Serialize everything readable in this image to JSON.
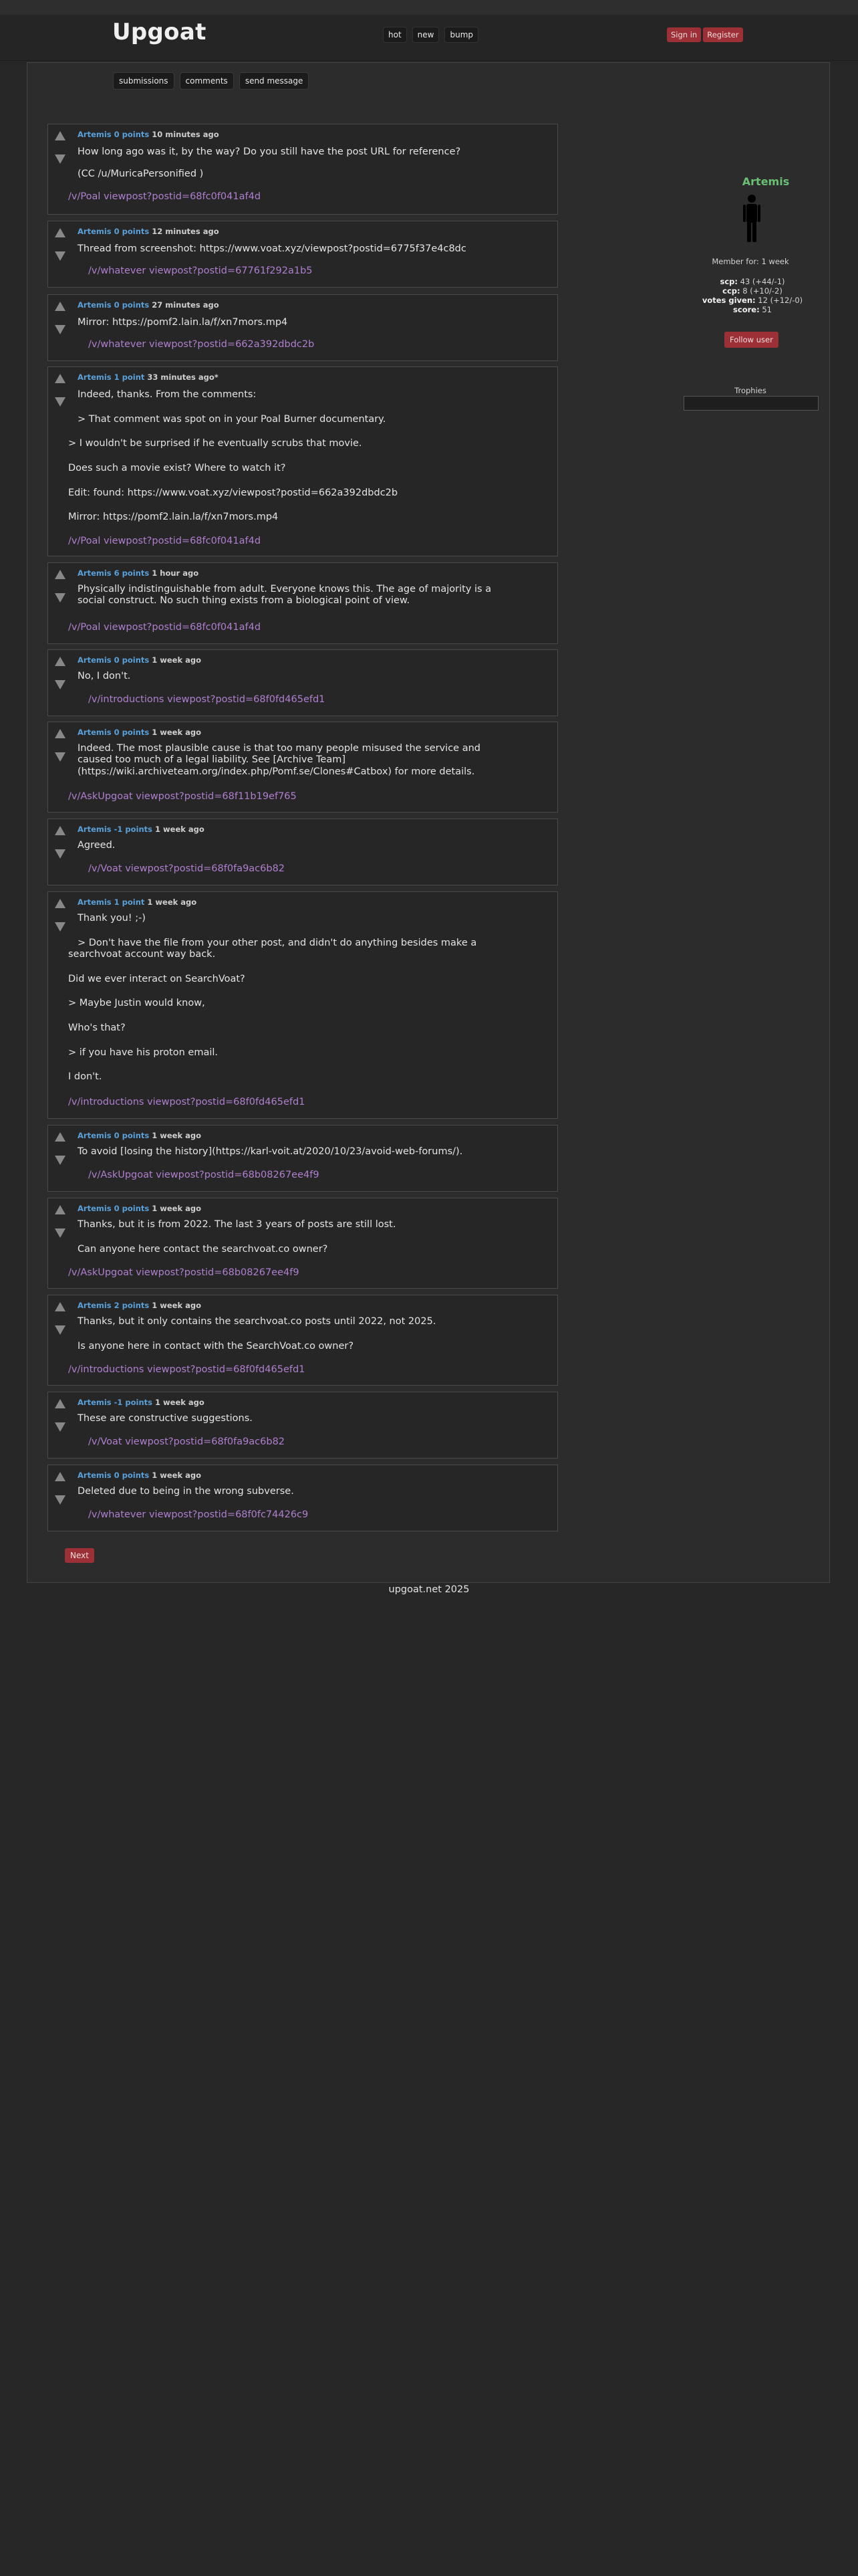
{
  "header": {
    "logo": "Upgoat",
    "nav": [
      "hot",
      "new",
      "bump"
    ],
    "sign_in": "Sign in",
    "register": "Register"
  },
  "subnav": [
    "submissions",
    "comments",
    "send message"
  ],
  "comments": [
    {
      "author": "Artemis",
      "points": "0 points",
      "time": "10 minutes ago",
      "lines": [
        "How long ago was it, by the way? Do you still have the post URL for reference?",
        "(CC /u/MuricaPersonified )"
      ],
      "link": "/v/Poal viewpost?postid=68fc0f041af4d"
    },
    {
      "author": "Artemis",
      "points": "0 points",
      "time": "12 minutes ago",
      "lines": [
        "Thread from screenshot: https://www.voat.xyz/viewpost?postid=6775f37e4c8dc"
      ],
      "link": "/v/whatever viewpost?postid=67761f292a1b5"
    },
    {
      "author": "Artemis",
      "points": "0 points",
      "time": "27 minutes ago",
      "lines": [
        "Mirror: https://pomf2.lain.la/f/xn7mors.mp4"
      ],
      "link": "/v/whatever viewpost?postid=662a392dbdc2b"
    },
    {
      "author": "Artemis",
      "points": "1 point",
      "time": "33 minutes ago*",
      "lines": [
        "Indeed, thanks. From the comments:",
        "> That comment was spot on in your Poal Burner documentary.",
        "> I wouldn't be surprised if he eventually scrubs that movie.",
        "Does such a movie exist? Where to watch it?",
        "Edit: found: https://www.voat.xyz/viewpost?postid=662a392dbdc2b",
        "Mirror: https://pomf2.lain.la/f/xn7mors.mp4"
      ],
      "link": "/v/Poal viewpost?postid=68fc0f041af4d"
    },
    {
      "author": "Artemis",
      "points": "6 points",
      "time": "1 hour ago",
      "lines": [
        "Physically indistinguishable from adult. Everyone knows this. The age of majority is a",
        "social construct. No such thing exists from a biological point of view."
      ],
      "link": "/v/Poal viewpost?postid=68fc0f041af4d"
    },
    {
      "author": "Artemis",
      "points": "0 points",
      "time": "1 week ago",
      "lines": [
        "No, I don't."
      ],
      "link": "/v/introductions viewpost?postid=68f0fd465efd1"
    },
    {
      "author": "Artemis",
      "points": "0 points",
      "time": "1 week ago",
      "lines": [
        "Indeed. The most plausible cause is that too many people misused the service and",
        "caused too much of a legal liability. See [Archive Team]",
        "(https://wiki.archiveteam.org/index.php/Pomf.se/Clones#Catbox) for more details."
      ],
      "link": "/v/AskUpgoat viewpost?postid=68f11b19ef765"
    },
    {
      "author": "Artemis",
      "points": "-1 points",
      "time": "1 week ago",
      "lines": [
        "Agreed."
      ],
      "link": "/v/Voat viewpost?postid=68f0fa9ac6b82"
    },
    {
      "author": "Artemis",
      "points": "1 point",
      "time": "1 week ago",
      "lines": [
        "Thank you! ;-)",
        "> Don't have the file from your other post, and didn't do anything besides make a",
        "searchvoat account way back.",
        "Did we ever interact on SearchVoat?",
        "> Maybe Justin would know,",
        "Who's that?",
        "> if you have his proton email.",
        "I don't."
      ],
      "link": "/v/introductions viewpost?postid=68f0fd465efd1"
    },
    {
      "author": "Artemis",
      "points": "0 points",
      "time": "1 week ago",
      "lines": [
        "To avoid [losing the history](https://karl-voit.at/2020/10/23/avoid-web-forums/)."
      ],
      "link": "/v/AskUpgoat viewpost?postid=68b08267ee4f9"
    },
    {
      "author": "Artemis",
      "points": "0 points",
      "time": "1 week ago",
      "lines": [
        "Thanks, but it is from 2022. The last 3 years of posts are still lost.",
        "Can anyone here contact the searchvoat.co owner?"
      ],
      "link": "/v/AskUpgoat viewpost?postid=68b08267ee4f9"
    },
    {
      "author": "Artemis",
      "points": "2 points",
      "time": "1 week ago",
      "lines": [
        "Thanks, but it only contains the searchvoat.co posts until 2022, not 2025.",
        "Is anyone here in contact with the SearchVoat.co owner?"
      ],
      "link": "/v/introductions viewpost?postid=68f0fd465efd1"
    },
    {
      "author": "Artemis",
      "points": "-1 points",
      "time": "1 week ago",
      "lines": [
        "These are constructive suggestions."
      ],
      "link": "/v/Voat viewpost?postid=68f0fa9ac6b82"
    },
    {
      "author": "Artemis",
      "points": "0 points",
      "time": "1 week ago",
      "lines": [
        "Deleted due to being in the wrong subverse."
      ],
      "link": "/v/whatever viewpost?postid=68f0fc74426c9"
    }
  ],
  "sidebar": {
    "username": "Artemis",
    "member_for": "Member for: 1 week",
    "stats": [
      {
        "label": "scp:",
        "value": "43 (+44/-1)"
      },
      {
        "label": "ccp:",
        "value": "8 (+10/-2)"
      },
      {
        "label": "votes given:",
        "value": "12 (+12/-0)"
      },
      {
        "label": "score:",
        "value": "51"
      }
    ],
    "follow": "Follow user",
    "trophies": "Trophies"
  },
  "pagination": {
    "next": "Next"
  },
  "footer": "upgoat.net 2025"
}
